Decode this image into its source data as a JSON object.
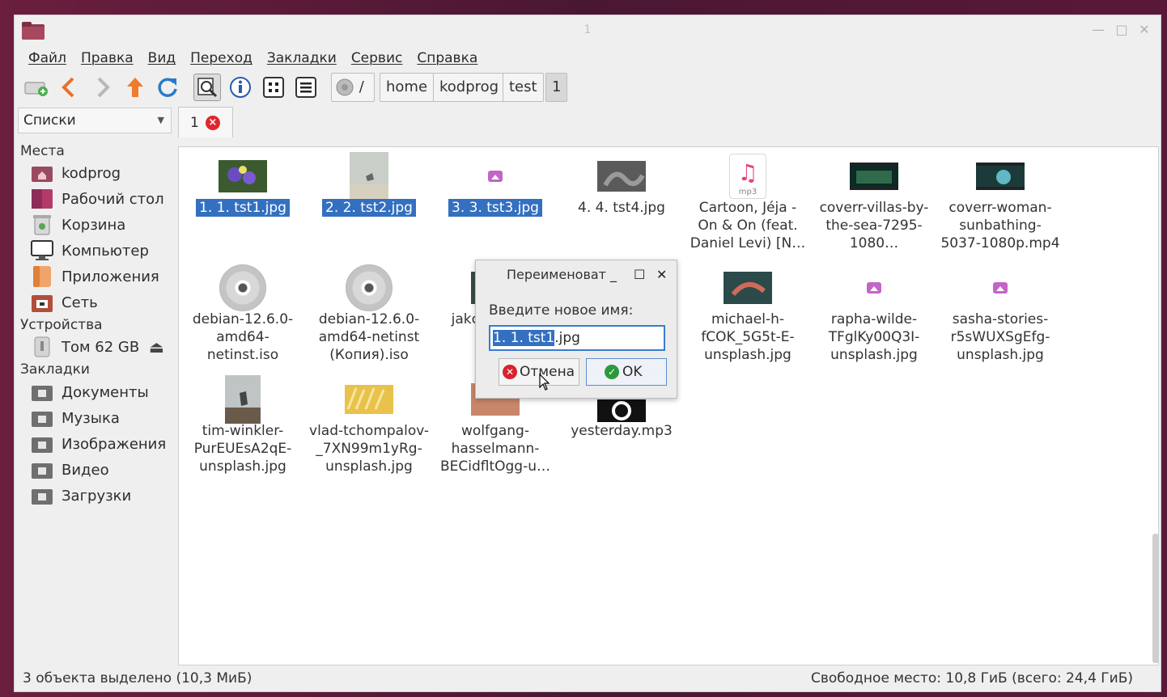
{
  "window": {
    "title": "1"
  },
  "menu": [
    "Файл",
    "Правка",
    "Вид",
    "Переход",
    "Закладки",
    "Сервис",
    "Справка"
  ],
  "toolbar": {
    "path_root": "/",
    "breadcrumbs": [
      "home",
      "kodprog",
      "test",
      "1"
    ]
  },
  "side_pane": {
    "selector": "Списки",
    "places_header": "Места",
    "places": [
      "kodprog",
      "Рабочий стол",
      "Корзина",
      "Компьютер",
      "Приложения",
      "Сеть"
    ],
    "devices_header": "Устройства",
    "devices": [
      "Том 62 GB"
    ],
    "bookmarks_header": "Закладки",
    "bookmarks": [
      "Документы",
      "Музыка",
      "Изображения",
      "Видео",
      "Загрузки"
    ]
  },
  "tab": {
    "label": "1"
  },
  "files": [
    {
      "name": "1. 1. tst1.jpg",
      "selected": true,
      "icon": "photo-thumbnail"
    },
    {
      "name": "2. 2. tst2.jpg",
      "selected": true,
      "icon": "photo-thumbnail"
    },
    {
      "name": "3. 3. tst3.jpg",
      "selected": true,
      "icon": "image-icon"
    },
    {
      "name": "4. 4. tst4.jpg",
      "selected": false,
      "icon": "photo-thumbnail"
    },
    {
      "name": "Cartoon, Jéja - On & On (feat. Daniel Levi) [N…",
      "selected": false,
      "icon": "mp3-icon"
    },
    {
      "name": "coverr-villas-by-the-sea-7295-1080…",
      "selected": false,
      "icon": "video-thumbnail"
    },
    {
      "name": "coverr-woman-sunbathing-5037-1080p.mp4",
      "selected": false,
      "icon": "video-thumbnail"
    },
    {
      "name": "debian-12.6.0-amd64-netinst.iso",
      "selected": false,
      "icon": "disc-icon"
    },
    {
      "name": "debian-12.6.0-amd64-netinst (Копия).iso",
      "selected": false,
      "icon": "disc-icon"
    },
    {
      "name": "jakc vQJl uns",
      "selected": false,
      "icon": "photo-thumbnail"
    },
    {
      "name": "",
      "selected": false,
      "icon": "hidden"
    },
    {
      "name": "michael-h-fCOK_5G5t-E-unsplash.jpg",
      "selected": false,
      "icon": "photo-thumbnail"
    },
    {
      "name": "rapha-wilde-TFglKy00Q3I-unsplash.jpg",
      "selected": false,
      "icon": "image-icon"
    },
    {
      "name": "sasha-stories-r5sWUXSgEfg-unsplash.jpg",
      "selected": false,
      "icon": "image-icon"
    },
    {
      "name": "tim-winkler-PurEUEsA2qE-unsplash.jpg",
      "selected": false,
      "icon": "photo-thumbnail"
    },
    {
      "name": "vlad-tchompalov-_7XN99m1yRg-unsplash.jpg",
      "selected": false,
      "icon": "photo-thumbnail"
    },
    {
      "name": "wolfgang-hasselmann-BECidfltOgg-u…",
      "selected": false,
      "icon": "photo-thumbnail"
    },
    {
      "name": "yesterday.mp3",
      "selected": false,
      "icon": "audio-thumbnail"
    }
  ],
  "status": {
    "left": "3 объекта выделено (10,3 МиБ)",
    "right": "Свободное место: 10,8 ГиБ (всего: 24,4 ГиБ)"
  },
  "rename_dialog": {
    "title": "Переименоват",
    "prompt": "Введите новое имя:",
    "value_selected": "1. 1. tst1",
    "value_rest": ".jpg",
    "cancel_label": "Отмена",
    "ok_label": "OK"
  }
}
